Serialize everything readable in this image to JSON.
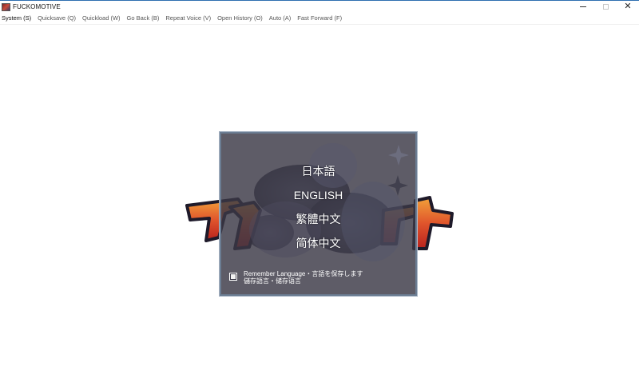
{
  "window": {
    "title": "FUCKOMOTIVE",
    "close_symbol": "✕"
  },
  "menu": {
    "items": [
      "System (S)",
      "Quicksave (Q)",
      "Quickload (W)",
      "Go Back (B)",
      "Repeat Voice (V)",
      "Open History (O)",
      "Auto (A)",
      "Fast Forward (F)"
    ]
  },
  "language_dialog": {
    "options": [
      "日本語",
      "ENGLISH",
      "繁體中文",
      "简体中文"
    ],
    "remember_line1": "Remember Language・言語を保存します",
    "remember_line2": "儲存語言・储存语言",
    "remember_checked": true
  },
  "colors": {
    "dialog_border": "#6b7d93",
    "dialog_background": "#3a3846",
    "logo_red": "#d8382a",
    "logo_orange": "#f2a23a",
    "logo_outline": "#1e1a2a"
  },
  "icons": {
    "app": "app-icon",
    "minimize": "minimize-icon",
    "maximize": "maximize-icon",
    "close": "close-icon",
    "checkbox": "checkbox-icon"
  }
}
